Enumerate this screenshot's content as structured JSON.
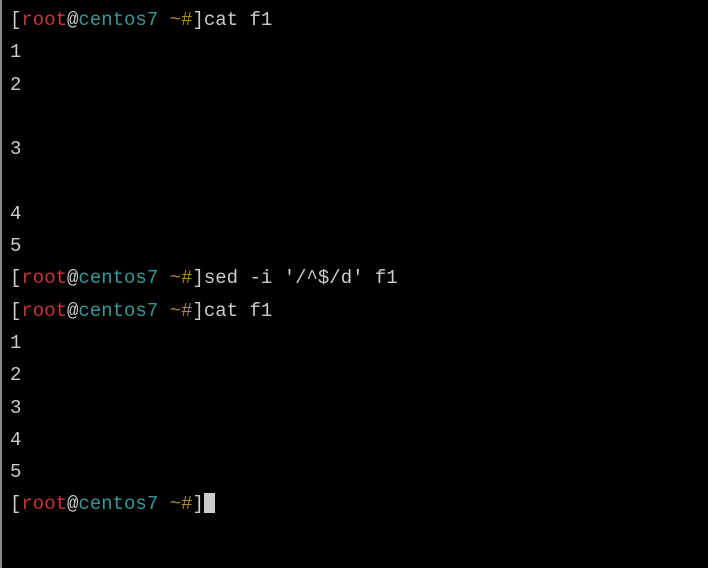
{
  "prompt": {
    "open_bracket": "[",
    "user": "root",
    "at": "@",
    "host": "centos7",
    "space": " ",
    "path": "~#",
    "close_bracket": "]"
  },
  "lines": [
    {
      "type": "cmd",
      "text": "cat f1"
    },
    {
      "type": "out",
      "text": "1"
    },
    {
      "type": "out",
      "text": "2"
    },
    {
      "type": "out",
      "text": ""
    },
    {
      "type": "out",
      "text": "3"
    },
    {
      "type": "out",
      "text": ""
    },
    {
      "type": "out",
      "text": "4"
    },
    {
      "type": "out",
      "text": "5"
    },
    {
      "type": "cmd",
      "text": "sed -i '/^$/d' f1"
    },
    {
      "type": "cmd",
      "text": "cat f1"
    },
    {
      "type": "out",
      "text": "1"
    },
    {
      "type": "out",
      "text": "2"
    },
    {
      "type": "out",
      "text": "3"
    },
    {
      "type": "out",
      "text": "4"
    },
    {
      "type": "out",
      "text": "5"
    },
    {
      "type": "cmd_cursor",
      "text": ""
    }
  ]
}
